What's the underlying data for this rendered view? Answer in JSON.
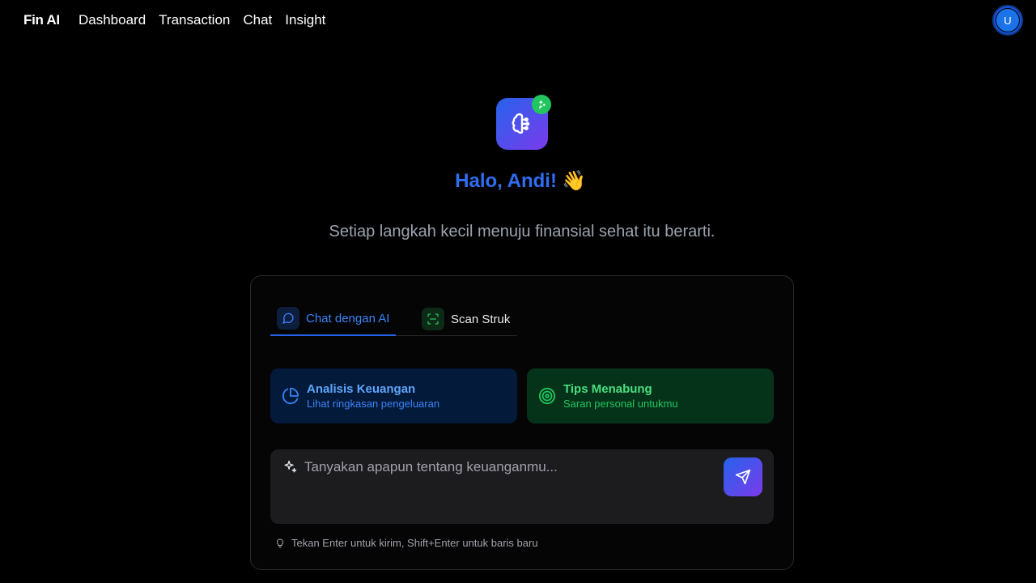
{
  "nav": {
    "brand": "Fin AI",
    "links": [
      "Dashboard",
      "Transaction",
      "Chat",
      "Insight"
    ],
    "avatar_initial": "U"
  },
  "hero": {
    "logo_icon": "brain-icon",
    "badge_icon": "sparkle-icon",
    "greeting": "Halo, Andi!",
    "greeting_emoji": "👋",
    "subtitle": "Setiap langkah kecil menuju finansial sehat itu berarti."
  },
  "tabs": [
    {
      "label": "Chat dengan AI",
      "icon": "chat-bubble-icon",
      "active": true
    },
    {
      "label": "Scan Struk",
      "icon": "scan-icon",
      "active": false
    }
  ],
  "quick_actions": [
    {
      "title": "Analisis Keuangan",
      "subtitle": "Lihat ringkasan pengeluaran",
      "icon": "pie-chart-icon"
    },
    {
      "title": "Tips Menabung",
      "subtitle": "Saran personal untukmu",
      "icon": "target-icon"
    }
  ],
  "composer": {
    "placeholder": "Tanyakan apapun tentang keuanganmu...",
    "value": "",
    "send_icon": "send-icon"
  },
  "hint": "Tekan Enter untuk kirim, Shift+Enter untuk baris baru",
  "colors": {
    "accent_blue": "#2563eb",
    "accent_purple": "#7c3aed",
    "accent_green": "#22c55e",
    "background": "#000000"
  }
}
